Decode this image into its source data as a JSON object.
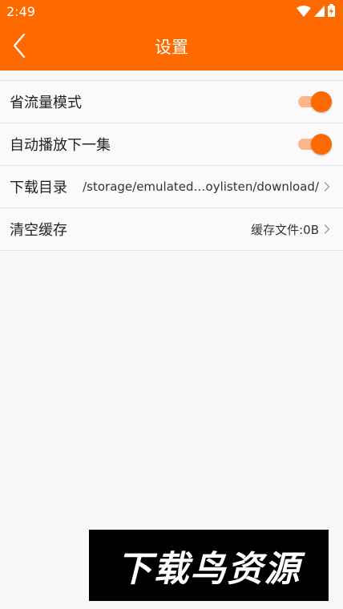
{
  "status_bar": {
    "time": "2:49",
    "icons": [
      "wifi-icon",
      "signal-icon",
      "battery-charging-icon"
    ]
  },
  "app_bar": {
    "title": "设置",
    "back_icon": "chevron-left-icon"
  },
  "settings": {
    "items": [
      {
        "label": "省流量模式",
        "type": "toggle",
        "enabled": true
      },
      {
        "label": "自动播放下一集",
        "type": "toggle",
        "enabled": true
      },
      {
        "label": "下载目录",
        "type": "link",
        "value": "/storage/emulated…oylisten/download/"
      },
      {
        "label": "清空缓存",
        "type": "link",
        "value": "缓存文件:0B"
      }
    ]
  },
  "watermark": {
    "text": "下载鸟资源"
  },
  "colors": {
    "accent": "#ff6a00",
    "toggle_track": "#ffb58a",
    "background": "#f8f8f8",
    "divider": "#e4e4e4"
  }
}
